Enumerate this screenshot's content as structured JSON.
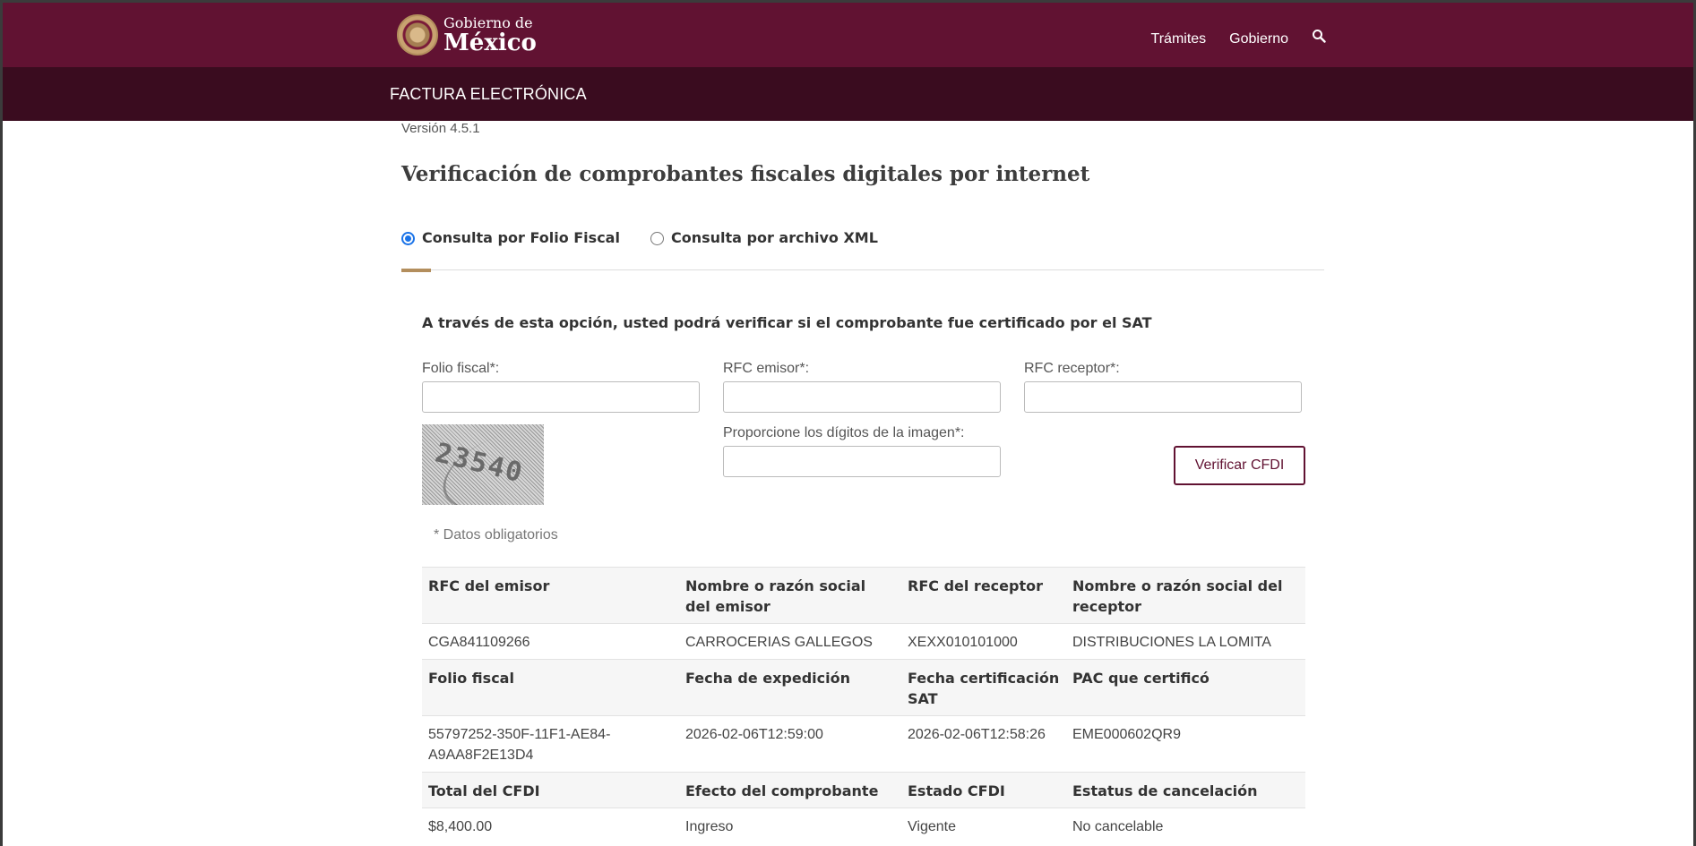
{
  "header": {
    "logo_line1": "Gobierno de",
    "logo_line2": "México",
    "nav": [
      "Trámites",
      "Gobierno"
    ]
  },
  "subheader": {
    "title": "FACTURA ELECTRÓNICA"
  },
  "main": {
    "version": "Versión 4.5.1",
    "title": "Verificación de comprobantes fiscales digitales por internet",
    "radios": [
      {
        "label": "Consulta por Folio Fiscal",
        "checked": true
      },
      {
        "label": "Consulta por archivo XML",
        "checked": false
      }
    ],
    "intro": "A través de esta opción, usted podrá verificar si el comprobante fue certificado por el SAT",
    "form": {
      "folio_label": "Folio fiscal*:",
      "folio_value": "",
      "rfc_emisor_label": "RFC emisor*:",
      "rfc_emisor_value": "",
      "rfc_receptor_label": "RFC receptor*:",
      "rfc_receptor_value": "",
      "captcha_label": "Proporcione los dígitos de la imagen*:",
      "captcha_value": "",
      "captcha_text": "23540",
      "verify_label": "Verificar CFDI",
      "required_note": "* Datos obligatorios"
    },
    "results": [
      {
        "type": "head",
        "cells": [
          "RFC del emisor",
          "Nombre o razón social del emisor",
          "RFC del receptor",
          "Nombre o razón social del receptor"
        ]
      },
      {
        "type": "val",
        "cells": [
          "CGA841109266",
          "CARROCERIAS GALLEGOS",
          "XEXX010101000",
          "DISTRIBUCIONES LA LOMITA"
        ]
      },
      {
        "type": "head",
        "cells": [
          "Folio fiscal",
          "Fecha de expedición",
          "Fecha certificación SAT",
          "PAC que certificó"
        ]
      },
      {
        "type": "val",
        "cells": [
          "55797252-350F-11F1-AE84-A9AA8F2E13D4",
          "2026-02-06T12:59:00",
          "2026-02-06T12:58:26",
          "EME000602QR9"
        ]
      },
      {
        "type": "head",
        "cells": [
          "Total del CFDI",
          "Efecto del comprobante",
          "Estado CFDI",
          "Estatus de cancelación"
        ]
      },
      {
        "type": "val",
        "cells": [
          " $8,400.00",
          "Ingreso",
          "Vigente",
          "No cancelable"
        ]
      }
    ]
  },
  "colors": {
    "primary": "#611232",
    "dark": "#3a0c1f",
    "accent": "#b38e5d"
  }
}
